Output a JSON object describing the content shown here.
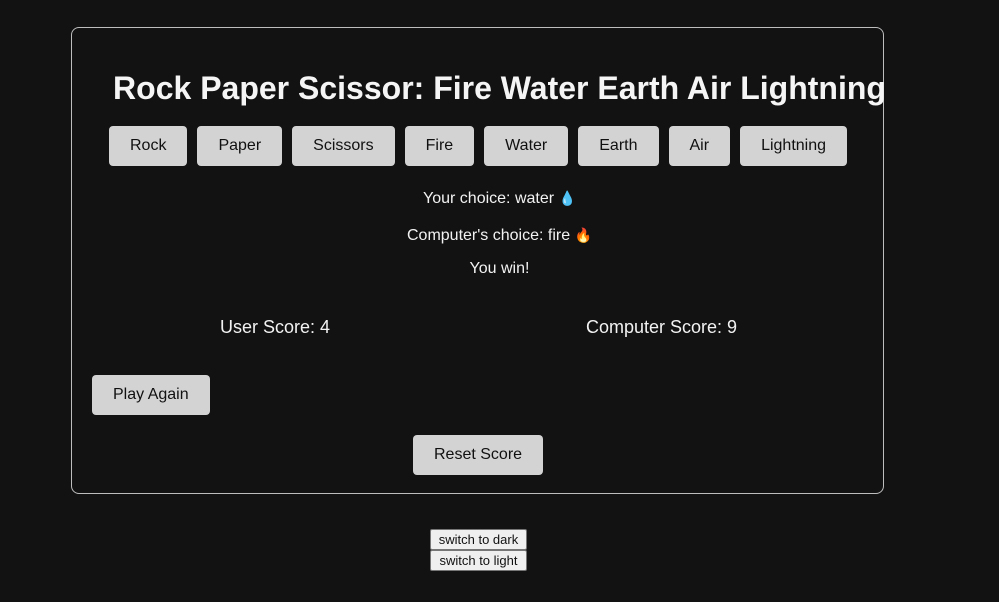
{
  "game": {
    "title": "Rock Paper Scissor: Fire Water Earth Air Lightning",
    "choices": [
      "Rock",
      "Paper",
      "Scissors",
      "Fire",
      "Water",
      "Earth",
      "Air",
      "Lightning"
    ],
    "user_choice_text": "Your choice: water",
    "user_choice_emoji": "💧",
    "computer_choice_text": "Computer's choice: fire",
    "computer_choice_emoji": "🔥",
    "result": "You win!",
    "user_score": "User Score: 4",
    "computer_score": "Computer Score: 9",
    "play_again_label": "Play Again",
    "reset_score_label": "Reset Score"
  },
  "theme": {
    "dark_label": "switch to dark",
    "light_label": "switch to light"
  },
  "colors": {
    "background": "#121212",
    "button": "#d3d3d3",
    "card_border": "#bdbdbd"
  }
}
